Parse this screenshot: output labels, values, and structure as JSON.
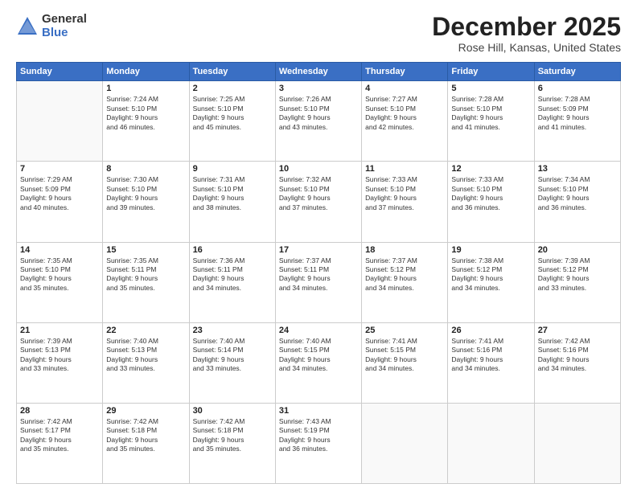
{
  "logo": {
    "general": "General",
    "blue": "Blue"
  },
  "header": {
    "title": "December 2025",
    "subtitle": "Rose Hill, Kansas, United States"
  },
  "days_of_week": [
    "Sunday",
    "Monday",
    "Tuesday",
    "Wednesday",
    "Thursday",
    "Friday",
    "Saturday"
  ],
  "weeks": [
    [
      {
        "day": "",
        "sunrise": "",
        "sunset": "",
        "daylight": ""
      },
      {
        "day": "1",
        "sunrise": "Sunrise: 7:24 AM",
        "sunset": "Sunset: 5:10 PM",
        "daylight": "Daylight: 9 hours and 46 minutes."
      },
      {
        "day": "2",
        "sunrise": "Sunrise: 7:25 AM",
        "sunset": "Sunset: 5:10 PM",
        "daylight": "Daylight: 9 hours and 45 minutes."
      },
      {
        "day": "3",
        "sunrise": "Sunrise: 7:26 AM",
        "sunset": "Sunset: 5:10 PM",
        "daylight": "Daylight: 9 hours and 43 minutes."
      },
      {
        "day": "4",
        "sunrise": "Sunrise: 7:27 AM",
        "sunset": "Sunset: 5:10 PM",
        "daylight": "Daylight: 9 hours and 42 minutes."
      },
      {
        "day": "5",
        "sunrise": "Sunrise: 7:28 AM",
        "sunset": "Sunset: 5:10 PM",
        "daylight": "Daylight: 9 hours and 41 minutes."
      },
      {
        "day": "6",
        "sunrise": "Sunrise: 7:28 AM",
        "sunset": "Sunset: 5:09 PM",
        "daylight": "Daylight: 9 hours and 41 minutes."
      }
    ],
    [
      {
        "day": "7",
        "sunrise": "Sunrise: 7:29 AM",
        "sunset": "Sunset: 5:09 PM",
        "daylight": "Daylight: 9 hours and 40 minutes."
      },
      {
        "day": "8",
        "sunrise": "Sunrise: 7:30 AM",
        "sunset": "Sunset: 5:10 PM",
        "daylight": "Daylight: 9 hours and 39 minutes."
      },
      {
        "day": "9",
        "sunrise": "Sunrise: 7:31 AM",
        "sunset": "Sunset: 5:10 PM",
        "daylight": "Daylight: 9 hours and 38 minutes."
      },
      {
        "day": "10",
        "sunrise": "Sunrise: 7:32 AM",
        "sunset": "Sunset: 5:10 PM",
        "daylight": "Daylight: 9 hours and 37 minutes."
      },
      {
        "day": "11",
        "sunrise": "Sunrise: 7:33 AM",
        "sunset": "Sunset: 5:10 PM",
        "daylight": "Daylight: 9 hours and 37 minutes."
      },
      {
        "day": "12",
        "sunrise": "Sunrise: 7:33 AM",
        "sunset": "Sunset: 5:10 PM",
        "daylight": "Daylight: 9 hours and 36 minutes."
      },
      {
        "day": "13",
        "sunrise": "Sunrise: 7:34 AM",
        "sunset": "Sunset: 5:10 PM",
        "daylight": "Daylight: 9 hours and 36 minutes."
      }
    ],
    [
      {
        "day": "14",
        "sunrise": "Sunrise: 7:35 AM",
        "sunset": "Sunset: 5:10 PM",
        "daylight": "Daylight: 9 hours and 35 minutes."
      },
      {
        "day": "15",
        "sunrise": "Sunrise: 7:35 AM",
        "sunset": "Sunset: 5:11 PM",
        "daylight": "Daylight: 9 hours and 35 minutes."
      },
      {
        "day": "16",
        "sunrise": "Sunrise: 7:36 AM",
        "sunset": "Sunset: 5:11 PM",
        "daylight": "Daylight: 9 hours and 34 minutes."
      },
      {
        "day": "17",
        "sunrise": "Sunrise: 7:37 AM",
        "sunset": "Sunset: 5:11 PM",
        "daylight": "Daylight: 9 hours and 34 minutes."
      },
      {
        "day": "18",
        "sunrise": "Sunrise: 7:37 AM",
        "sunset": "Sunset: 5:12 PM",
        "daylight": "Daylight: 9 hours and 34 minutes."
      },
      {
        "day": "19",
        "sunrise": "Sunrise: 7:38 AM",
        "sunset": "Sunset: 5:12 PM",
        "daylight": "Daylight: 9 hours and 34 minutes."
      },
      {
        "day": "20",
        "sunrise": "Sunrise: 7:39 AM",
        "sunset": "Sunset: 5:12 PM",
        "daylight": "Daylight: 9 hours and 33 minutes."
      }
    ],
    [
      {
        "day": "21",
        "sunrise": "Sunrise: 7:39 AM",
        "sunset": "Sunset: 5:13 PM",
        "daylight": "Daylight: 9 hours and 33 minutes."
      },
      {
        "day": "22",
        "sunrise": "Sunrise: 7:40 AM",
        "sunset": "Sunset: 5:13 PM",
        "daylight": "Daylight: 9 hours and 33 minutes."
      },
      {
        "day": "23",
        "sunrise": "Sunrise: 7:40 AM",
        "sunset": "Sunset: 5:14 PM",
        "daylight": "Daylight: 9 hours and 33 minutes."
      },
      {
        "day": "24",
        "sunrise": "Sunrise: 7:40 AM",
        "sunset": "Sunset: 5:15 PM",
        "daylight": "Daylight: 9 hours and 34 minutes."
      },
      {
        "day": "25",
        "sunrise": "Sunrise: 7:41 AM",
        "sunset": "Sunset: 5:15 PM",
        "daylight": "Daylight: 9 hours and 34 minutes."
      },
      {
        "day": "26",
        "sunrise": "Sunrise: 7:41 AM",
        "sunset": "Sunset: 5:16 PM",
        "daylight": "Daylight: 9 hours and 34 minutes."
      },
      {
        "day": "27",
        "sunrise": "Sunrise: 7:42 AM",
        "sunset": "Sunset: 5:16 PM",
        "daylight": "Daylight: 9 hours and 34 minutes."
      }
    ],
    [
      {
        "day": "28",
        "sunrise": "Sunrise: 7:42 AM",
        "sunset": "Sunset: 5:17 PM",
        "daylight": "Daylight: 9 hours and 35 minutes."
      },
      {
        "day": "29",
        "sunrise": "Sunrise: 7:42 AM",
        "sunset": "Sunset: 5:18 PM",
        "daylight": "Daylight: 9 hours and 35 minutes."
      },
      {
        "day": "30",
        "sunrise": "Sunrise: 7:42 AM",
        "sunset": "Sunset: 5:18 PM",
        "daylight": "Daylight: 9 hours and 35 minutes."
      },
      {
        "day": "31",
        "sunrise": "Sunrise: 7:43 AM",
        "sunset": "Sunset: 5:19 PM",
        "daylight": "Daylight: 9 hours and 36 minutes."
      },
      {
        "day": "",
        "sunrise": "",
        "sunset": "",
        "daylight": ""
      },
      {
        "day": "",
        "sunrise": "",
        "sunset": "",
        "daylight": ""
      },
      {
        "day": "",
        "sunrise": "",
        "sunset": "",
        "daylight": ""
      }
    ]
  ]
}
